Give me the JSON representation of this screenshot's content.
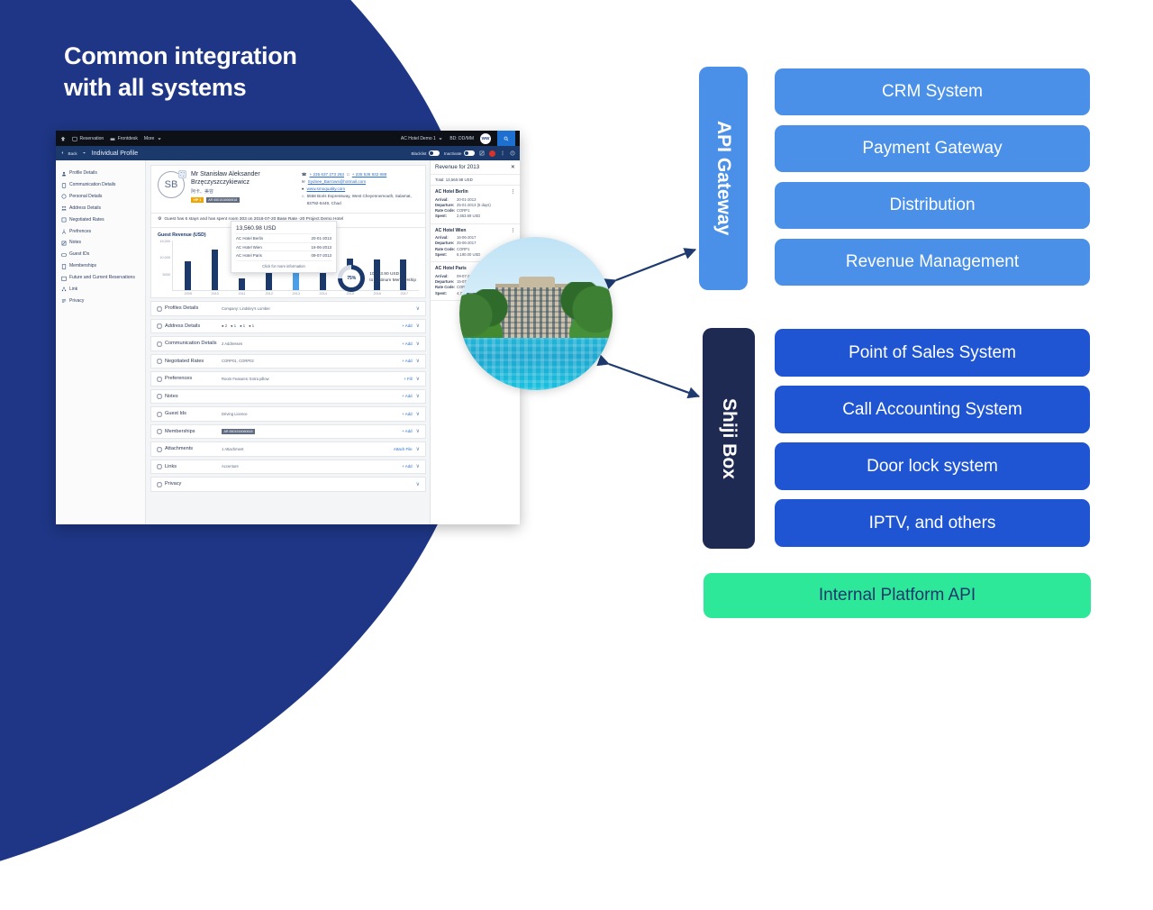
{
  "slide": {
    "title_line1": "Common integration",
    "title_line2": "with all systems",
    "bg_navy": "#1e3685"
  },
  "api_gateway": {
    "tab_label": "API Gateway",
    "tab_color": "#4a90e8",
    "items": [
      {
        "label": "CRM System"
      },
      {
        "label": "Payment Gateway"
      },
      {
        "label": "Distribution"
      },
      {
        "label": "Revenue Management"
      }
    ]
  },
  "shiji_box": {
    "tab_label": "Shiji Box",
    "tab_color": "#1e2a52",
    "items": [
      {
        "label": "Point of Sales System"
      },
      {
        "label": "Call Accounting System"
      },
      {
        "label": "Door lock system"
      },
      {
        "label": "IPTV, and others"
      }
    ]
  },
  "internal_api": {
    "label": "Internal Platform API",
    "color": "#2ee89a"
  },
  "app": {
    "topbar": {
      "home_icon": "home-icon",
      "items": [
        {
          "label": "Reservation",
          "icon": "calendar-icon"
        },
        {
          "label": "Frontdesk",
          "icon": "desk-icon"
        },
        {
          "label": "More",
          "icon": "chevron-down-icon"
        }
      ],
      "property": "AC Hotel Demo 1",
      "business_date": "BD: DD/MM",
      "avatar": "WW",
      "search_icon": "search-icon"
    },
    "subbar": {
      "back": "Back",
      "title": "Individual Profile",
      "blacklist": "Blacklist",
      "inactivate": "Inactivate",
      "edit_icon": "edit-icon",
      "alert_icon": "alert-icon",
      "more_icon": "kebab-menu-icon",
      "help_icon": "help-icon"
    },
    "sidebar": [
      {
        "label": "Profile Details",
        "icon": "person-icon"
      },
      {
        "label": "Communication Details",
        "icon": "phone-icon"
      },
      {
        "label": "Personal Details",
        "icon": "id-icon"
      },
      {
        "label": "Address Details",
        "icon": "address-icon"
      },
      {
        "label": "Negotiated Rates",
        "icon": "rates-icon"
      },
      {
        "label": "Prefrences",
        "icon": "preferences-icon"
      },
      {
        "label": "Notes",
        "icon": "notes-icon"
      },
      {
        "label": "Guest IDs",
        "icon": "card-icon"
      },
      {
        "label": "Memberships",
        "icon": "membership-icon"
      },
      {
        "label": "Future and Current Reservations",
        "icon": "calendar-icon"
      },
      {
        "label": "Link",
        "icon": "link-icon"
      },
      {
        "label": "Privacy",
        "icon": "privacy-icon"
      }
    ],
    "profile": {
      "initials": "SB",
      "name": "Mr Stanisław Aleksander Brzęczyszczykiewicz",
      "name_cjk": "阿卡、美容",
      "vip_badge": "VIP 1",
      "id_badge": "AR 6501516060618",
      "phone1": "+ 235 637 273 263",
      "phone2": "+ 235 536 832 888",
      "email": "Sydnee_Barrows@hotmail.com",
      "website": "www.smoquality.com",
      "address": "5558 Boris Expressway, West Cheyennemouth, Salamat, 83792-5449, Chad"
    },
    "stay_note": "Guest has 6 stays and has spent room 303 on 2016-07-20 Base Rate -20 Project Demo Hotel",
    "chart": {
      "title": "Guest Revenue (USD)"
    },
    "tooltip": {
      "total": "13,560.98 USD",
      "rows": [
        {
          "hotel": "AC Hotel Berlin",
          "date": "20-01-2013"
        },
        {
          "hotel": "AC Hotel Wien",
          "date": "16-06-2013"
        },
        {
          "hotel": "AC Hotel Paris",
          "date": "09-07-2013"
        }
      ],
      "link": "Click for more information"
    },
    "donut": {
      "percent": "75%",
      "amount": "10,563.90 USD",
      "caption": "to Platinum Membership"
    },
    "accordion": [
      {
        "label": "Profiles Details",
        "icon": "person-icon",
        "value": "Company: Lindsley's Lumber",
        "action": "",
        "chip": false
      },
      {
        "label": "Address Details",
        "icon": "address-icon",
        "value": "",
        "action": "+ Add",
        "counts": [
          "2",
          "1",
          "1",
          "1"
        ]
      },
      {
        "label": "Communication Details",
        "icon": "phone-icon",
        "value": "2 Addresses",
        "action": "+ Add",
        "chip": false
      },
      {
        "label": "Negotiated Rates",
        "icon": "rates-icon",
        "value": "CORP01, CORP02",
        "action": "+ Add",
        "chip": false
      },
      {
        "label": "Preferences",
        "icon": "preferences-icon",
        "value": "Room Features: Extra pillow",
        "action": "+ Fill",
        "chip": false
      },
      {
        "label": "Notes",
        "icon": "notes-icon",
        "value": "",
        "action": "+ Add",
        "chip": false
      },
      {
        "label": "Guest Ids",
        "icon": "card-icon",
        "value": "Driving Licence",
        "action": "+ Add",
        "chip": false
      },
      {
        "label": "Memberships",
        "icon": "membership-icon",
        "value": "AR 6501516060618",
        "action": "+ Add",
        "chip": true
      },
      {
        "label": "Attachments",
        "icon": "attachment-icon",
        "value": "1 Attachment",
        "action": "Attach File",
        "chip": false
      },
      {
        "label": "Links",
        "icon": "link-icon",
        "value": "Accenture",
        "action": "+ Add",
        "chip": false
      },
      {
        "label": "Privacy",
        "icon": "privacy-icon",
        "value": "",
        "action": "",
        "chip": false
      }
    ],
    "revenue": {
      "title": "Revenue for 2013",
      "close_icon": "close-icon",
      "total": "Total:  13,560.98 USD",
      "labels": {
        "arrival": "Arrival:",
        "departure": "Departure:",
        "rate_code": "Rate Code:",
        "spent": "Spent:"
      },
      "blocks": [
        {
          "hotel": "AC Hotel Berlin",
          "arrival": "20-01-2013",
          "departure": "25-01-2013 (5 days)",
          "rate_code": "CORP1",
          "spent": "2,653.69 USD"
        },
        {
          "hotel": "AC Hotel Wien",
          "arrival": "16-06-2017",
          "departure": "25-06-2017",
          "rate_code": "CORP1",
          "spent": "6,190.00 USD"
        },
        {
          "hotel": "AC Hotel Paris",
          "arrival": "09-07-2013",
          "departure": "15-07-2013",
          "rate_code": "CORP2",
          "spent": "4,717.29 USD"
        }
      ]
    }
  },
  "chart_data": {
    "type": "bar",
    "title": "Guest Revenue (USD)",
    "xlabel": "",
    "ylabel": "USD",
    "categories": [
      "2009",
      "2010",
      "2011",
      "2012",
      "2013",
      "2014",
      "2015",
      "2016",
      "2017"
    ],
    "values": [
      8600,
      12100,
      3500,
      7600,
      13561,
      9200,
      9400,
      9200,
      9300
    ],
    "highlight_index": 4,
    "ytick_labels": [
      "5000",
      "10,000",
      "15,000"
    ],
    "yticks": [
      5000,
      10000,
      15000
    ],
    "ylim": [
      0,
      15000
    ],
    "grid": false,
    "legend": false,
    "bar_color": "#1b3a6b",
    "highlight_color": "#4a9fe8"
  }
}
